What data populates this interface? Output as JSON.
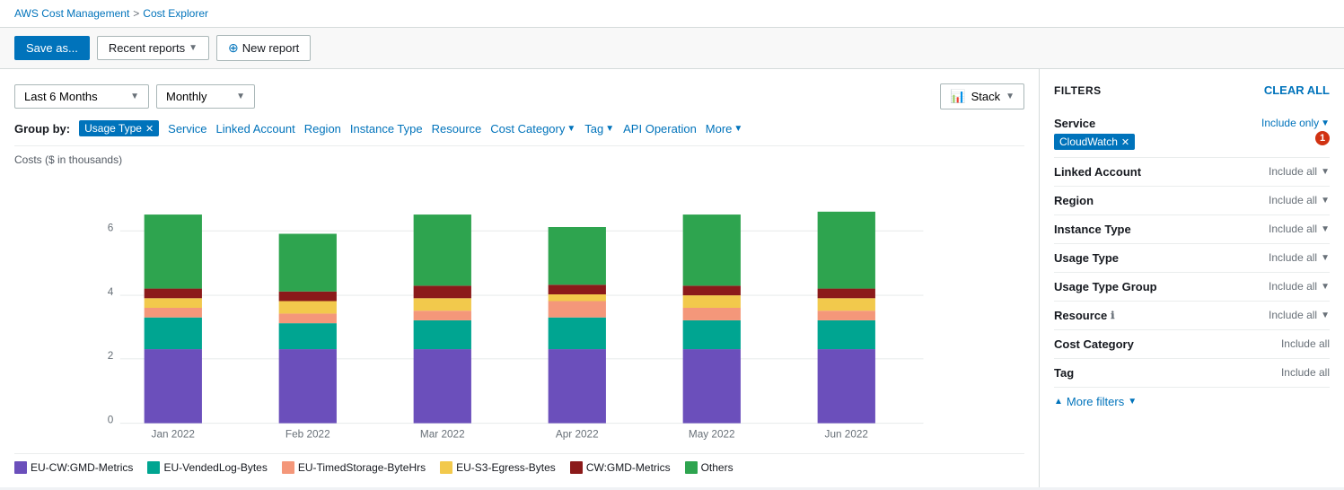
{
  "breadcrumb": {
    "parent": "AWS Cost Management",
    "separator": ">",
    "current": "Cost Explorer"
  },
  "toolbar": {
    "save_label": "Save as...",
    "recent_label": "Recent reports",
    "new_report_label": "New report"
  },
  "controls": {
    "date_range": "Last 6 Months",
    "granularity": "Monthly",
    "stack_label": "Stack"
  },
  "group_by": {
    "label": "Group by:",
    "active_tag": "Usage Type",
    "links": [
      "Service",
      "Linked Account",
      "Region",
      "Instance Type",
      "Resource",
      "Cost Category",
      "Tag",
      "API Operation",
      "More"
    ]
  },
  "chart": {
    "y_axis_label": "Costs ($ in thousands)",
    "bars": [
      {
        "month": "Jan 2022",
        "eu_cw_gmd": 2.3,
        "eu_vended": 1.0,
        "eu_timed": 0.3,
        "eu_s3": 0.3,
        "cw_gmd": 0.3,
        "others": 2.3
      },
      {
        "month": "Feb 2022",
        "eu_cw_gmd": 2.3,
        "eu_vended": 0.8,
        "eu_timed": 0.3,
        "eu_s3": 0.4,
        "cw_gmd": 0.3,
        "others": 1.7
      },
      {
        "month": "Mar 2022",
        "eu_cw_gmd": 2.3,
        "eu_vended": 0.9,
        "eu_timed": 0.3,
        "eu_s3": 0.4,
        "cw_gmd": 0.4,
        "others": 2.3
      },
      {
        "month": "Apr 2022",
        "eu_cw_gmd": 2.3,
        "eu_vended": 1.0,
        "eu_timed": 0.5,
        "eu_s3": 0.2,
        "cw_gmd": 0.3,
        "others": 1.8
      },
      {
        "month": "May 2022",
        "eu_cw_gmd": 2.3,
        "eu_vended": 0.9,
        "eu_timed": 0.4,
        "eu_s3": 0.4,
        "cw_gmd": 0.3,
        "others": 2.3
      },
      {
        "month": "Jun 2022",
        "eu_cw_gmd": 2.3,
        "eu_vended": 0.9,
        "eu_timed": 0.3,
        "eu_s3": 0.3,
        "cw_gmd": 0.3,
        "others": 2.4
      }
    ],
    "colors": {
      "eu_cw_gmd": "#6b4fbb",
      "eu_vended": "#00a591",
      "eu_timed": "#f4977a",
      "eu_s3": "#f2c94c",
      "cw_gmd": "#8b1a1a",
      "others": "#2ea44f"
    },
    "y_ticks": [
      "0",
      "2",
      "4",
      "6"
    ],
    "legend": [
      {
        "key": "eu_cw_gmd",
        "label": "EU-CW:GMD-Metrics",
        "color": "#6b4fbb"
      },
      {
        "key": "eu_vended",
        "label": "EU-VendedLog-Bytes",
        "color": "#00a591"
      },
      {
        "key": "eu_timed",
        "label": "EU-TimedStorage-ByteHrs",
        "color": "#f4977a"
      },
      {
        "key": "eu_s3",
        "label": "EU-S3-Egress-Bytes",
        "color": "#f2c94c"
      },
      {
        "key": "cw_gmd",
        "label": "CW:GMD-Metrics",
        "color": "#8b1a1a"
      },
      {
        "key": "others",
        "label": "Others",
        "color": "#2ea44f"
      }
    ]
  },
  "filters": {
    "title": "FILTERS",
    "clear_all": "CLEAR ALL",
    "service": {
      "label": "Service",
      "control": "Include only",
      "active_filter": "CloudWatch",
      "badge": "1"
    },
    "linked_account": {
      "label": "Linked Account",
      "control": "Include all"
    },
    "region": {
      "label": "Region",
      "control": "Include all"
    },
    "instance_type": {
      "label": "Instance Type",
      "control": "Include all"
    },
    "usage_type": {
      "label": "Usage Type",
      "control": "Include all"
    },
    "usage_type_group": {
      "label": "Usage Type Group",
      "control": "Include all"
    },
    "resource": {
      "label": "Resource",
      "control": "Include all",
      "info": true
    },
    "cost_category": {
      "label": "Cost Category",
      "control": "Include all"
    },
    "tag": {
      "label": "Tag",
      "control": "Include all"
    },
    "more_filters": "More filters"
  }
}
